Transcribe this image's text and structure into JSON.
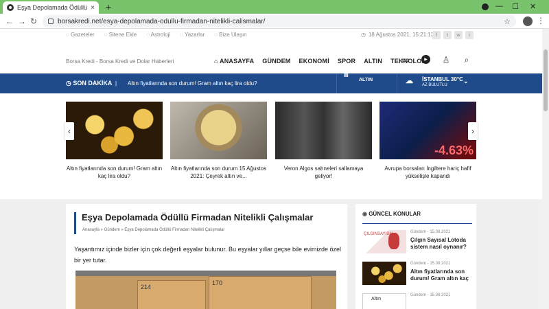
{
  "browser": {
    "tab_title": "Eşya Depolamada Ödüllü Firmada",
    "tab_close": "×",
    "newtab": "+",
    "url": "borsakredi.net/esya-depolamada-odullu-firmadan-nitelikli-calismalar/",
    "back": "←",
    "forward": "→",
    "reload": "↻",
    "star": "☆",
    "kebab": "⋮",
    "minimize": "—",
    "maximize": "☐",
    "close": "✕"
  },
  "toplinks": [
    "Gazeteler",
    "Sitene Ekle",
    "Astroloji",
    "Yazarlar",
    "Bize Ulaşın"
  ],
  "date": "18 Ağustos 2021, 15:21:13",
  "date_icon": "◷",
  "socials": [
    "f",
    "t",
    "w",
    "i"
  ],
  "logo_alt": "Borsa Kredi - Borsa Kredi ve Dolar Haberleri",
  "nav": [
    "ANASAYFA",
    "GÜNDEM",
    "EKONOMİ",
    "SPOR",
    "ALTIN",
    "TEKNOLOJİ"
  ],
  "header_icons": {
    "gallery": "▭",
    "play": "▶",
    "user": "♙",
    "search": "⌕"
  },
  "breaking": {
    "label": "SON DAKİKA",
    "sep": "|",
    "text": "Altın fiyatlarında son durum! Gram altın kaç lira oldu?",
    "gold": "ALTIN",
    "city": "İSTANBUL 30°C",
    "weather": "AZ BULUTLU",
    "chevron": "⌄"
  },
  "slides": [
    {
      "caption": "Altın fiyatlarında son durum! Gram altın kaç lira oldu?"
    },
    {
      "caption": "Altın fiyatlarında son durum 15 Ağustos 2021: Çeyrek altın ve..."
    },
    {
      "caption": "Veron Algos sahneleri sallamaya geliyor!"
    },
    {
      "caption": "Avrupa borsaları İngiltere hariç hafif yükselişle kapandı"
    }
  ],
  "stock_text": "-4.63%",
  "arrows": {
    "prev": "‹",
    "next": "›"
  },
  "article": {
    "title": "Eşya Depolamada Ödüllü Firmadan Nitelikli Çalışmalar",
    "breadcrumb": "Anasayfa » Gündem » Eşya Depolamada Ödüllü Firmadan Nitelikli Çalışmalar",
    "body": "Yaşantımız içinde bizler için çok değerli eşyalar bulunur. Bu eşyalar yıllar geçse bile evimizde özel bir yer tutar.",
    "crate_labels": [
      "214",
      "170"
    ]
  },
  "sidebar": {
    "heading": "GÜNCEL KONULAR",
    "items": [
      {
        "meta": "Gündem  -  15.08.2021",
        "title": "Çılgın Sayısal Lotoda sistem nasıl oynanır?",
        "thumb_text": "ÇILGINSAYISAL"
      },
      {
        "meta": "Gündem  -  15.08.2021",
        "title": "Altın fiyatlarında son durum! Gram altın kaç",
        "thumb_text": ""
      },
      {
        "meta": "Gündem  -  15.08.2021",
        "title": "",
        "thumb_text": "Altın"
      }
    ]
  }
}
